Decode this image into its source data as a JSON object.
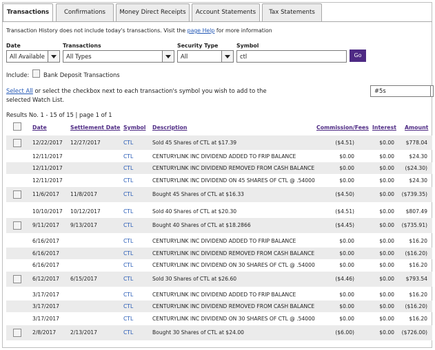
{
  "tabs": [
    {
      "label": "Transactions",
      "active": true
    },
    {
      "label": "Confirmations",
      "active": false
    },
    {
      "label": "Money Direct Receipts",
      "active": false
    },
    {
      "label": "Account Statements",
      "active": false
    },
    {
      "label": "Tax Statements",
      "active": false
    }
  ],
  "info": {
    "before": "Transaction History does not include today's transactions. Visit the ",
    "link": "page Help",
    "after": " for more information"
  },
  "filters": {
    "date_label": "Date",
    "date_value": "All Available",
    "transactions_label": "Transactions",
    "transactions_value": "All Types",
    "security_label": "Security Type",
    "security_value": "All",
    "symbol_label": "Symbol",
    "symbol_value": "ctl",
    "go_label": "Go"
  },
  "include": {
    "label": "Include:",
    "bank_label": "Bank Deposit Transactions"
  },
  "watchlist": {
    "select_all": "Select All",
    "text": " or select the checkbox next to each transaction's symbol you wish to add to the selected Watch List.",
    "value": "#5s"
  },
  "results_text": "Results No. 1 - 15 of 15 | page 1 of 1",
  "columns": {
    "date": "Date",
    "settlement": "Settlement Date",
    "symbol": "Symbol",
    "description": "Description",
    "commission": "Commission/Fees",
    "interest": "Interest",
    "amount": "Amount"
  },
  "rows": [
    {
      "checkbox": true,
      "date": "12/22/2017",
      "settle": "12/27/2017",
      "symbol": "CTL",
      "desc": "Sold 45 Shares of CTL at $17.39",
      "comm": "($4.51)",
      "interest": "$0.00",
      "amount": "$778.04"
    },
    {
      "checkbox": false,
      "date": "12/11/2017",
      "settle": "",
      "symbol": "CTL",
      "desc": "CENTURYLINK INC DIVIDEND ADDED TO FRIP BALANCE",
      "comm": "$0.00",
      "interest": "$0.00",
      "amount": "$24.30"
    },
    {
      "checkbox": false,
      "date": "12/11/2017",
      "settle": "",
      "symbol": "CTL",
      "desc": "CENTURYLINK INC DIVIDEND REMOVED FROM CASH BALANCE",
      "comm": "$0.00",
      "interest": "$0.00",
      "amount": "($24.30)"
    },
    {
      "checkbox": false,
      "date": "12/11/2017",
      "settle": "",
      "symbol": "CTL",
      "desc": "CENTURYLINK INC DIVIDEND ON 45 SHARES OF CTL @ .54000",
      "comm": "$0.00",
      "interest": "$0.00",
      "amount": "$24.30"
    },
    {
      "checkbox": true,
      "date": "11/6/2017",
      "settle": "11/8/2017",
      "symbol": "CTL",
      "desc": "Bought 45 Shares of CTL at $16.33",
      "comm": "($4.50)",
      "interest": "$0.00",
      "amount": "($739.35)"
    },
    {
      "checkbox": false,
      "date": "10/10/2017",
      "settle": "10/12/2017",
      "symbol": "CTL",
      "desc": "Sold 40 Shares of CTL at $20.30",
      "comm": "($4.51)",
      "interest": "$0.00",
      "amount": "$807.49"
    },
    {
      "checkbox": true,
      "date": "9/11/2017",
      "settle": "9/13/2017",
      "symbol": "CTL",
      "desc": "Bought 40 Shares of CTL at $18.2866",
      "comm": "($4.45)",
      "interest": "$0.00",
      "amount": "($735.91)"
    },
    {
      "checkbox": false,
      "date": "6/16/2017",
      "settle": "",
      "symbol": "CTL",
      "desc": "CENTURYLINK INC DIVIDEND ADDED TO FRIP BALANCE",
      "comm": "$0.00",
      "interest": "$0.00",
      "amount": "$16.20"
    },
    {
      "checkbox": false,
      "date": "6/16/2017",
      "settle": "",
      "symbol": "CTL",
      "desc": "CENTURYLINK INC DIVIDEND REMOVED FROM CASH BALANCE",
      "comm": "$0.00",
      "interest": "$0.00",
      "amount": "($16.20)"
    },
    {
      "checkbox": false,
      "date": "6/16/2017",
      "settle": "",
      "symbol": "CTL",
      "desc": "CENTURYLINK INC DIVIDEND ON 30 SHARES OF CTL @ .54000",
      "comm": "$0.00",
      "interest": "$0.00",
      "amount": "$16.20"
    },
    {
      "checkbox": true,
      "date": "6/12/2017",
      "settle": "6/15/2017",
      "symbol": "CTL",
      "desc": "Sold 30 Shares of CTL at $26.60",
      "comm": "($4.46)",
      "interest": "$0.00",
      "amount": "$793.54"
    },
    {
      "checkbox": false,
      "date": "3/17/2017",
      "settle": "",
      "symbol": "CTL",
      "desc": "CENTURYLINK INC DIVIDEND ADDED TO FRIP BALANCE",
      "comm": "$0.00",
      "interest": "$0.00",
      "amount": "$16.20"
    },
    {
      "checkbox": false,
      "date": "3/17/2017",
      "settle": "",
      "symbol": "CTL",
      "desc": "CENTURYLINK INC DIVIDEND REMOVED FROM CASH BALANCE",
      "comm": "$0.00",
      "interest": "$0.00",
      "amount": "($16.20)"
    },
    {
      "checkbox": false,
      "date": "3/17/2017",
      "settle": "",
      "symbol": "CTL",
      "desc": "CENTURYLINK INC DIVIDEND ON 30 SHARES OF CTL @ .54000",
      "comm": "$0.00",
      "interest": "$0.00",
      "amount": "$16.20"
    },
    {
      "checkbox": true,
      "date": "2/8/2017",
      "settle": "2/13/2017",
      "symbol": "CTL",
      "desc": "Bought 30 Shares of CTL at $24.00",
      "comm": "($6.00)",
      "interest": "$0.00",
      "amount": "($726.00)"
    }
  ],
  "colors": {
    "accent": "#4e2a84",
    "link": "#2257b5",
    "shaded_row": "#ebebeb"
  }
}
